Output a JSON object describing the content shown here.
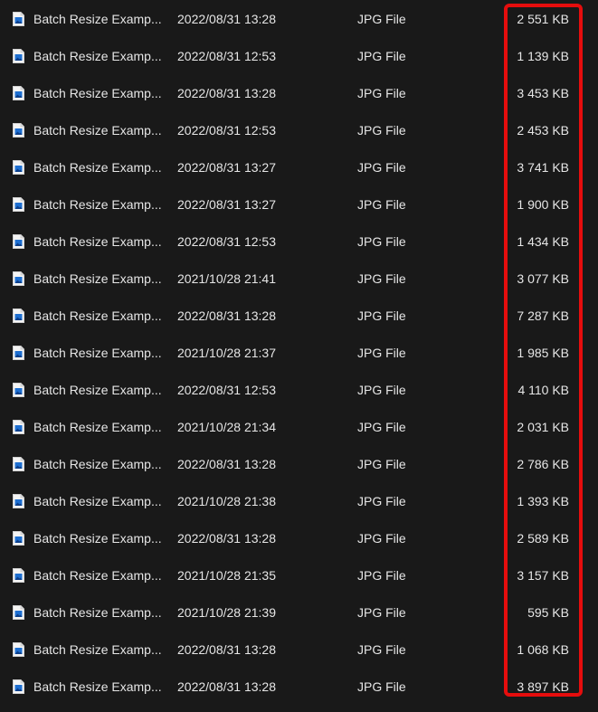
{
  "highlight": {
    "color": "#e60d0d"
  },
  "file_icon": "jpg-file-icon",
  "files": [
    {
      "name": "Batch Resize Examp...",
      "date": "2022/08/31 13:28",
      "type": "JPG File",
      "size": "2 551 KB"
    },
    {
      "name": "Batch Resize Examp...",
      "date": "2022/08/31 12:53",
      "type": "JPG File",
      "size": "1 139 KB"
    },
    {
      "name": "Batch Resize Examp...",
      "date": "2022/08/31 13:28",
      "type": "JPG File",
      "size": "3 453 KB"
    },
    {
      "name": "Batch Resize Examp...",
      "date": "2022/08/31 12:53",
      "type": "JPG File",
      "size": "2 453 KB"
    },
    {
      "name": "Batch Resize Examp...",
      "date": "2022/08/31 13:27",
      "type": "JPG File",
      "size": "3 741 KB"
    },
    {
      "name": "Batch Resize Examp...",
      "date": "2022/08/31 13:27",
      "type": "JPG File",
      "size": "1 900 KB"
    },
    {
      "name": "Batch Resize Examp...",
      "date": "2022/08/31 12:53",
      "type": "JPG File",
      "size": "1 434 KB"
    },
    {
      "name": "Batch Resize Examp...",
      "date": "2021/10/28 21:41",
      "type": "JPG File",
      "size": "3 077 KB"
    },
    {
      "name": "Batch Resize Examp...",
      "date": "2022/08/31 13:28",
      "type": "JPG File",
      "size": "7 287 KB"
    },
    {
      "name": "Batch Resize Examp...",
      "date": "2021/10/28 21:37",
      "type": "JPG File",
      "size": "1 985 KB"
    },
    {
      "name": "Batch Resize Examp...",
      "date": "2022/08/31 12:53",
      "type": "JPG File",
      "size": "4 110 KB"
    },
    {
      "name": "Batch Resize Examp...",
      "date": "2021/10/28 21:34",
      "type": "JPG File",
      "size": "2 031 KB"
    },
    {
      "name": "Batch Resize Examp...",
      "date": "2022/08/31 13:28",
      "type": "JPG File",
      "size": "2 786 KB"
    },
    {
      "name": "Batch Resize Examp...",
      "date": "2021/10/28 21:38",
      "type": "JPG File",
      "size": "1 393 KB"
    },
    {
      "name": "Batch Resize Examp...",
      "date": "2022/08/31 13:28",
      "type": "JPG File",
      "size": "2 589 KB"
    },
    {
      "name": "Batch Resize Examp...",
      "date": "2021/10/28 21:35",
      "type": "JPG File",
      "size": "3 157 KB"
    },
    {
      "name": "Batch Resize Examp...",
      "date": "2021/10/28 21:39",
      "type": "JPG File",
      "size": "595 KB"
    },
    {
      "name": "Batch Resize Examp...",
      "date": "2022/08/31 13:28",
      "type": "JPG File",
      "size": "1 068 KB"
    },
    {
      "name": "Batch Resize Examp...",
      "date": "2022/08/31 13:28",
      "type": "JPG File",
      "size": "3 897 KB"
    }
  ]
}
